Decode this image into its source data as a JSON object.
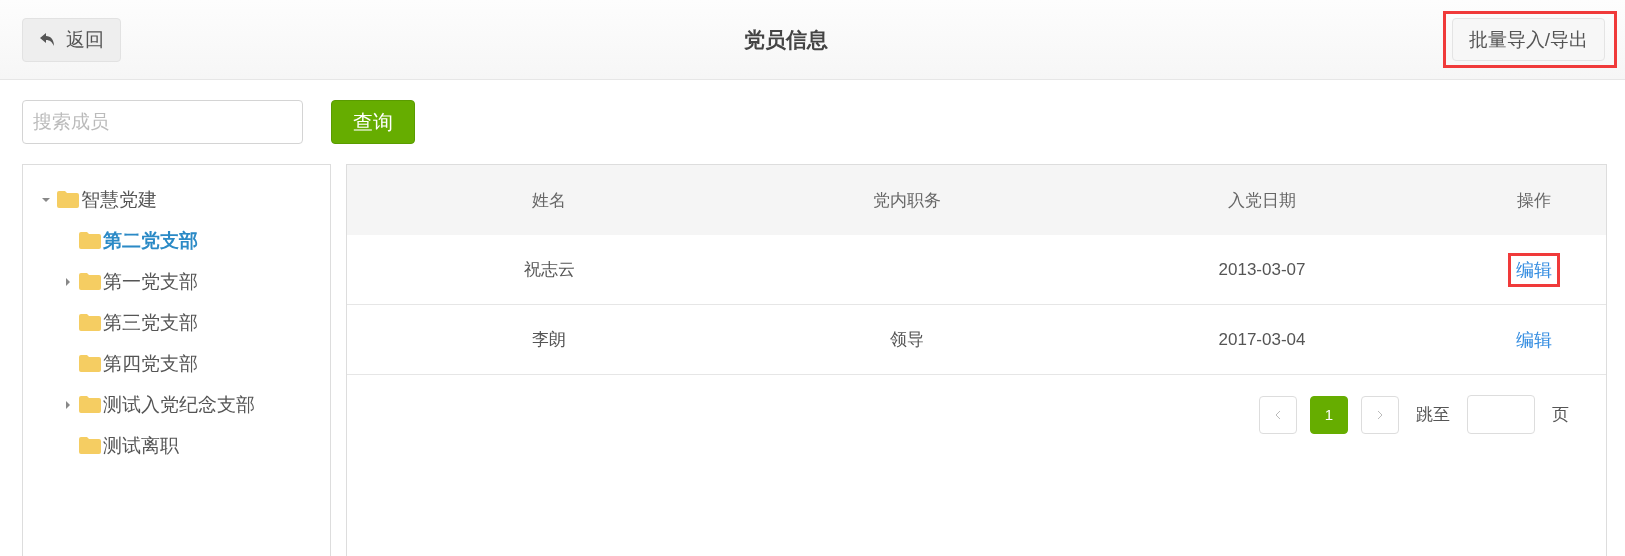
{
  "header": {
    "back_button": "返回",
    "title": "党员信息",
    "export_button": {
      "label": "批量导入/导出",
      "highlighted": true
    }
  },
  "search": {
    "placeholder": "搜索成员",
    "button": "查询"
  },
  "tree": [
    {
      "label": "智慧党建",
      "expanded": true,
      "active": false,
      "children": [
        {
          "label": "第二党支部",
          "active": true
        },
        {
          "label": "第一党支部",
          "expanded": false,
          "active": false
        },
        {
          "label": "第三党支部",
          "active": false
        },
        {
          "label": "第四党支部",
          "active": false
        },
        {
          "label": "测试入党纪念支部",
          "expanded": false,
          "active": false
        },
        {
          "label": "测试离职",
          "active": false
        }
      ]
    }
  ],
  "table": {
    "columns": [
      "姓名",
      "党内职务",
      "入党日期",
      "操作"
    ],
    "rows": [
      {
        "name": "祝志云",
        "role": "",
        "date": "2013-03-07",
        "action": {
          "label": "编辑",
          "highlighted": true
        }
      },
      {
        "name": "李朗",
        "role": "领导",
        "date": "2017-03-04",
        "action": {
          "label": "编辑",
          "highlighted": false
        }
      }
    ]
  },
  "pagination": {
    "pages": [
      {
        "label": "1",
        "selected": true
      }
    ],
    "jump_label": "跳至",
    "page_unit": "页"
  }
}
